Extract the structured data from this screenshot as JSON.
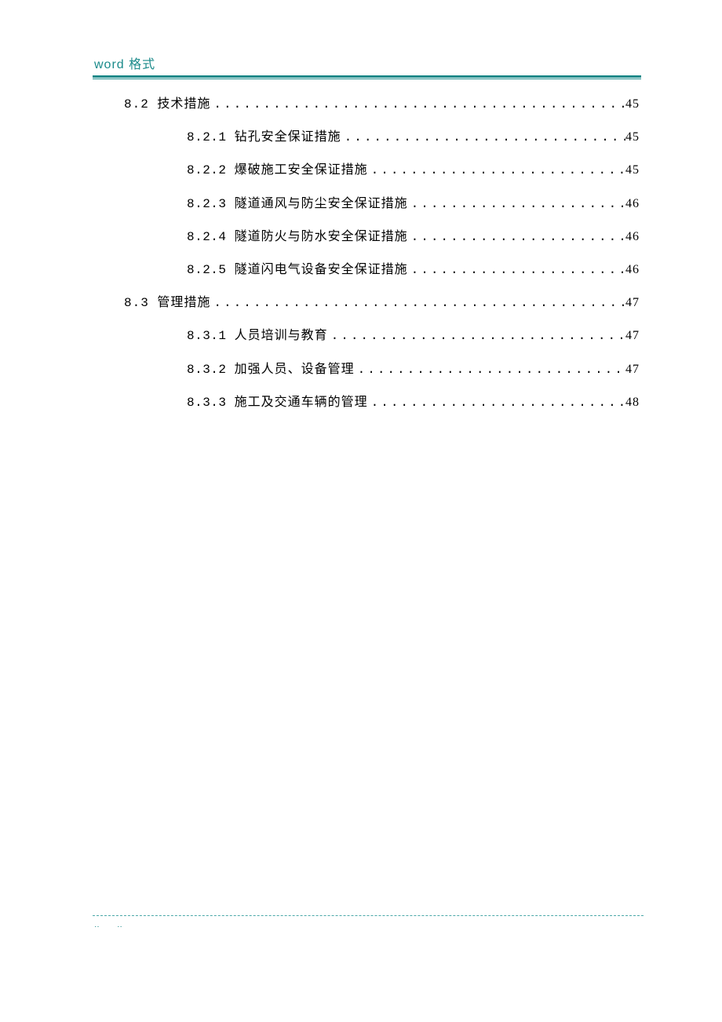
{
  "header": {
    "label": "word 格式"
  },
  "toc": [
    {
      "level": 2,
      "num": "8.2 ",
      "title": "技术措施",
      "page": "45"
    },
    {
      "level": 3,
      "num": "8.2.1 ",
      "title": "钻孔安全保证措施",
      "page": "45"
    },
    {
      "level": 3,
      "num": "8.2.2 ",
      "title": "爆破施工安全保证措施",
      "page": "45"
    },
    {
      "level": 3,
      "num": "8.2.3 ",
      "title": "隧道通风与防尘安全保证措施",
      "page": "46"
    },
    {
      "level": 3,
      "num": "8.2.4 ",
      "title": "隧道防火与防水安全保证措施",
      "page": "46"
    },
    {
      "level": 3,
      "num": "8.2.5 ",
      "title": "隧道闪电气设备安全保证措施",
      "page": "46"
    },
    {
      "level": 2,
      "num": "8.3 ",
      "title": "管理措施",
      "page": "47"
    },
    {
      "level": 3,
      "num": "8.3.1 ",
      "title": "人员培训与教育",
      "page": "47"
    },
    {
      "level": 3,
      "num": "8.3.2 ",
      "title": "加强人员、设备管理",
      "page": "47"
    },
    {
      "level": 3,
      "num": "8.3.3 ",
      "title": "施工及交通车辆的管理",
      "page": "48"
    }
  ],
  "footer": {
    "marks": "‥ ‥"
  },
  "dots": "................................................................................................"
}
